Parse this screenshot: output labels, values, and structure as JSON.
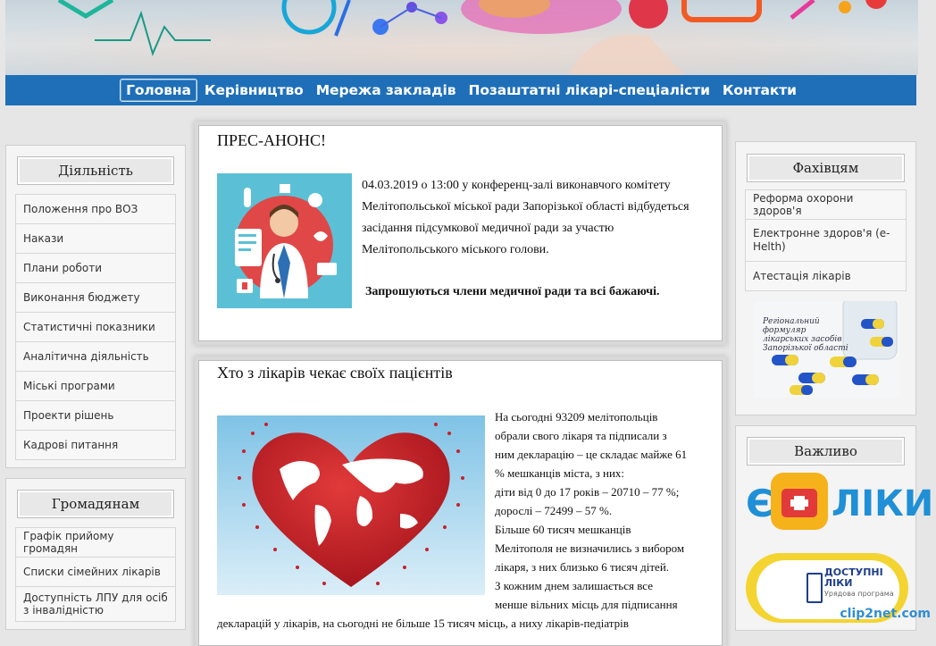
{
  "nav": {
    "items": [
      "Головна",
      "Керівництво",
      "Мережа закладів",
      "Позаштатні лікарі-спеціалісти",
      "Контакти"
    ]
  },
  "left": {
    "sections": [
      {
        "title": "Діяльність",
        "items": [
          "Положення про ВОЗ",
          "Накази",
          "Плани роботи",
          "Виконання бюджету",
          "Статистичні показники",
          "Аналітична діяльність",
          "Міські програми",
          "Проекти рішень",
          "Кадрові питання"
        ]
      },
      {
        "title": "Громадянам",
        "items": [
          "Графік прийому громадян",
          "Списки сімейних лікарів",
          "Доступність ЛПУ для осіб з інвалідністю"
        ]
      }
    ]
  },
  "right": {
    "specialists": {
      "title": "Фахівцям",
      "items": [
        "Реформа охорони здоров'я",
        "Електронне здоров'я (e-Helth)",
        "Атестація лікарів"
      ],
      "image_text": "Регіональний формуляр лікарських засобів Запорізької області"
    },
    "important": {
      "title": "Важливо",
      "eliky_left": "Є",
      "eliky_right": "ЛІКИ",
      "dostupni_1": "ДОСТУПНІ",
      "dostupni_2": "ЛІКИ",
      "dostupni_3": "Урядова програма"
    }
  },
  "news": [
    {
      "title": "ПРЕС-АНОНС!",
      "text": "04.03.2019 о 13:00 у конференц-залі виконавчого комітету Мелітопольської міської ради Запорізької області відбудеться засідання підсумкової медичної ради за участю Мелітопольського міського голови.",
      "bold": "Запрошуються члени медичної ради та всі бажаючі."
    },
    {
      "title": "Хто з лікарів чекає своїх пацієнтів",
      "lines": [
        "На сьогодні 93209 мелітопольців",
        "обрали свого лікаря та підписали з",
        "ним декларацію – це складає майже 61",
        "% мешканців міста, з них:",
        "діти від 0 до 17 років – 20710 – 77 %;",
        "дорослі – 72499 – 57 %.",
        "Більше 60 тисяч мешканців",
        "Мелітополя не визначились з вибором",
        "лікаря, з них близько 6 тисяч дітей.",
        "З кожним днем залишається все",
        "менше вільних місць для підписання",
        "декларацій у лікарів, на сьогодні не більше 15 тисяч місць, а ниху лікарів-педіатрів"
      ]
    }
  ],
  "watermark": "clip2net.com",
  "colors": {
    "nav": "#1e6fb8",
    "accent_blue": "#2f8ed3",
    "heart": "#c8202a"
  }
}
